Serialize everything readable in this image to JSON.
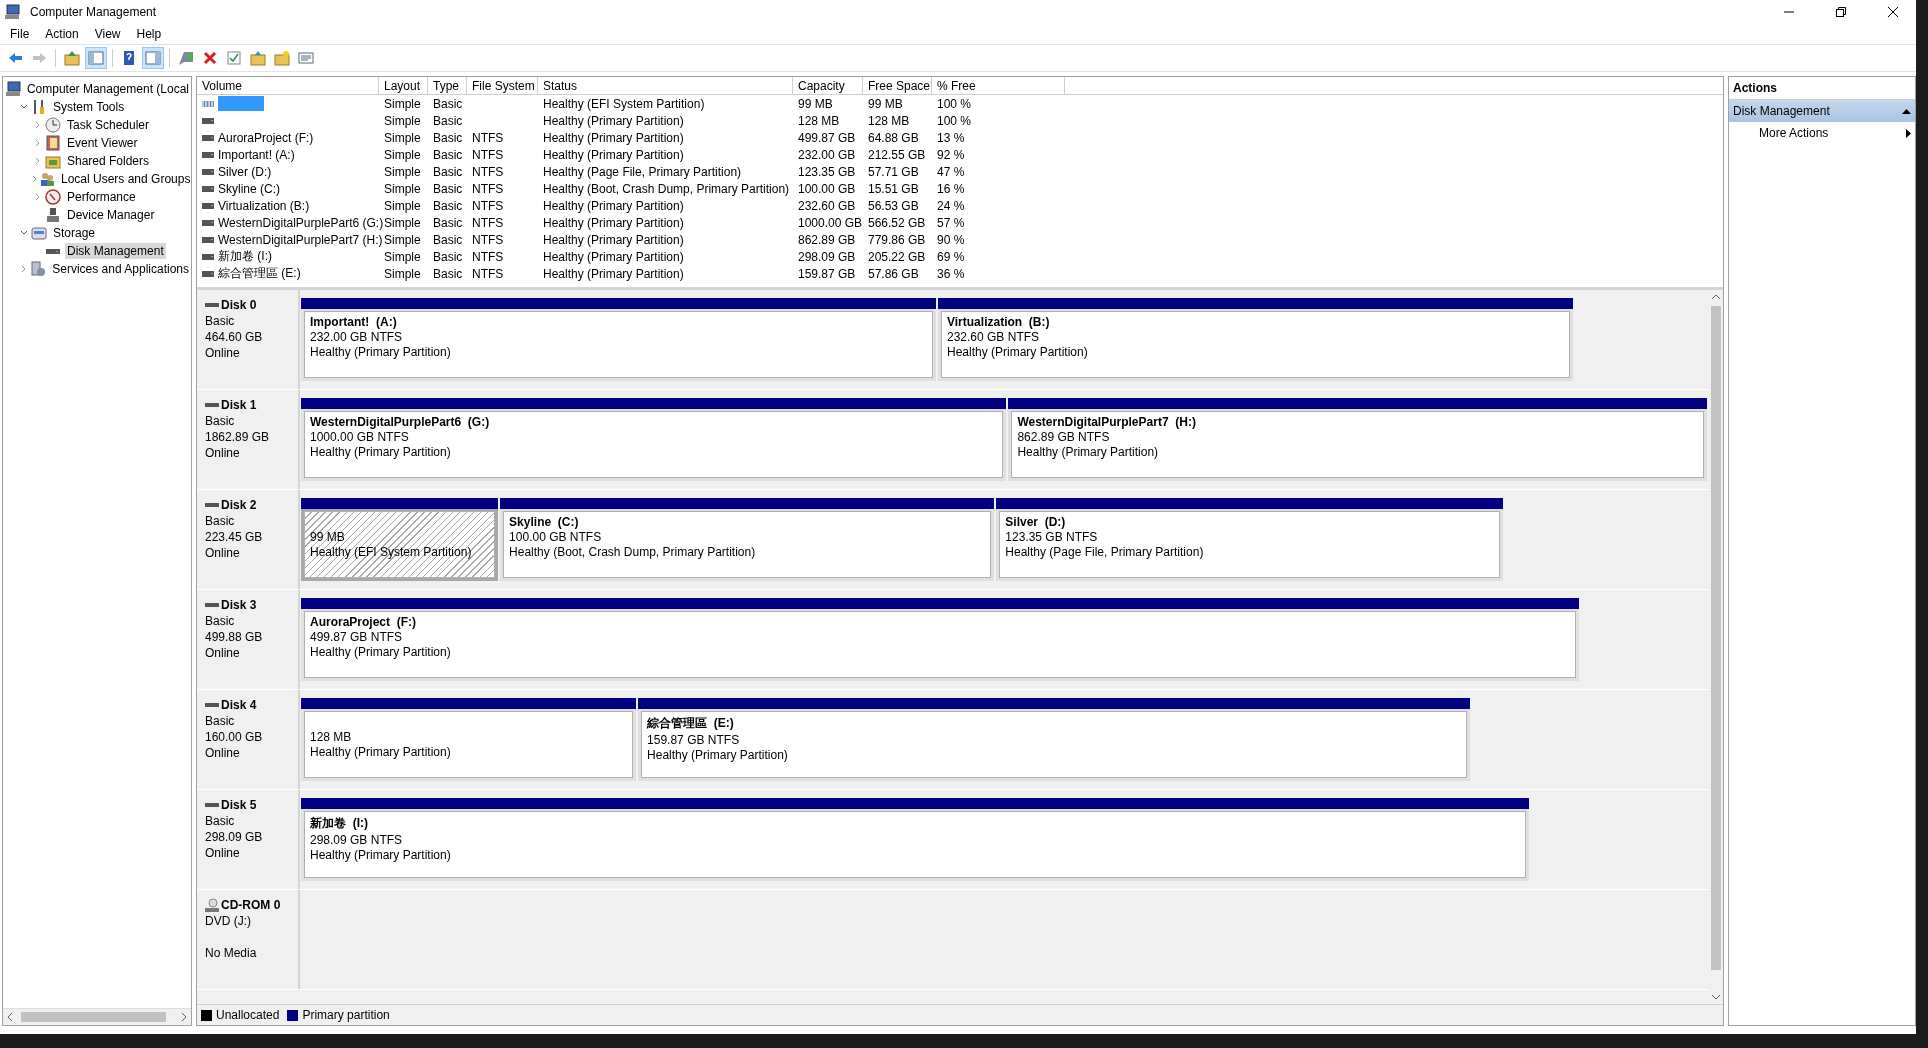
{
  "window": {
    "title": "Computer Management"
  },
  "menu": [
    "File",
    "Action",
    "View",
    "Help"
  ],
  "toolbar": [
    {
      "kind": "back",
      "disabled": false,
      "pressed": false
    },
    {
      "kind": "forward",
      "disabled": true,
      "pressed": false
    },
    {
      "kind": "separator"
    },
    {
      "kind": "up",
      "disabled": false,
      "pressed": false
    },
    {
      "kind": "tree-pane",
      "disabled": false,
      "pressed": true
    },
    {
      "kind": "separator"
    },
    {
      "kind": "help",
      "disabled": false,
      "pressed": false
    },
    {
      "kind": "action-pane",
      "disabled": false,
      "pressed": true
    },
    {
      "kind": "separator"
    },
    {
      "kind": "connect",
      "disabled": false,
      "pressed": false
    },
    {
      "kind": "delete",
      "disabled": false,
      "pressed": false
    },
    {
      "kind": "properties",
      "disabled": false,
      "pressed": false
    },
    {
      "kind": "folder-up",
      "disabled": false,
      "pressed": false
    },
    {
      "kind": "folder-star",
      "disabled": false,
      "pressed": false
    },
    {
      "kind": "list",
      "disabled": false,
      "pressed": false
    }
  ],
  "tree": [
    {
      "label": "Computer Management (Local",
      "selected": false,
      "children": [
        {
          "label": "System Tools",
          "expanded": true,
          "selected": false,
          "children": [
            {
              "label": "Task Scheduler",
              "expanded": false,
              "selected": false
            },
            {
              "label": "Event Viewer",
              "expanded": false,
              "selected": false
            },
            {
              "label": "Shared Folders",
              "expanded": false,
              "selected": false
            },
            {
              "label": "Local Users and Groups",
              "expanded": false,
              "selected": false
            },
            {
              "label": "Performance",
              "expanded": false,
              "selected": false
            },
            {
              "label": "Device Manager",
              "selected": false
            }
          ]
        },
        {
          "label": "Storage",
          "expanded": true,
          "selected": false,
          "children": [
            {
              "label": "Disk Management",
              "selected": true
            }
          ]
        },
        {
          "label": "Services and Applications",
          "expanded": false,
          "selected": false
        }
      ]
    }
  ],
  "volumes": {
    "columns": [
      "Volume",
      "Layout",
      "Type",
      "File System",
      "Status",
      "Capacity",
      "Free Space",
      "% Free"
    ],
    "rows": [
      {
        "kind": "efi",
        "selected": true,
        "layout": "Simple",
        "type": "Basic",
        "status": "Healthy (EFI System Partition)",
        "capacity": "99 MB",
        "free_space": "99 MB",
        "pct_free": "100 %"
      },
      {
        "kind": "disk",
        "selected": false,
        "layout": "Simple",
        "type": "Basic",
        "status": "Healthy (Primary Partition)",
        "capacity": "128 MB",
        "free_space": "128 MB",
        "pct_free": "100 %"
      },
      {
        "kind": "disk",
        "selected": false,
        "volume": "AuroraProject (F:)",
        "layout": "Simple",
        "type": "Basic",
        "file_system": "NTFS",
        "status": "Healthy (Primary Partition)",
        "capacity": "499.87 GB",
        "free_space": "64.88 GB",
        "pct_free": "13 %"
      },
      {
        "kind": "disk",
        "selected": false,
        "volume": "Important! (A:)",
        "layout": "Simple",
        "type": "Basic",
        "file_system": "NTFS",
        "status": "Healthy (Primary Partition)",
        "capacity": "232.00 GB",
        "free_space": "212.55 GB",
        "pct_free": "92 %"
      },
      {
        "kind": "disk",
        "selected": false,
        "volume": "Silver (D:)",
        "layout": "Simple",
        "type": "Basic",
        "file_system": "NTFS",
        "status": "Healthy (Page File, Primary Partition)",
        "capacity": "123.35 GB",
        "free_space": "57.71 GB",
        "pct_free": "47 %"
      },
      {
        "kind": "disk",
        "selected": false,
        "volume": "Skyline (C:)",
        "layout": "Simple",
        "type": "Basic",
        "file_system": "NTFS",
        "status": "Healthy (Boot, Crash Dump, Primary Partition)",
        "capacity": "100.00 GB",
        "free_space": "15.51 GB",
        "pct_free": "16 %"
      },
      {
        "kind": "disk",
        "selected": false,
        "volume": "Virtualization (B:)",
        "layout": "Simple",
        "type": "Basic",
        "file_system": "NTFS",
        "status": "Healthy (Primary Partition)",
        "capacity": "232.60 GB",
        "free_space": "56.53 GB",
        "pct_free": "24 %"
      },
      {
        "kind": "disk",
        "selected": false,
        "volume": "WesternDigitalPurplePart6 (G:)",
        "layout": "Simple",
        "type": "Basic",
        "file_system": "NTFS",
        "status": "Healthy (Primary Partition)",
        "capacity": "1000.00 GB",
        "free_space": "566.52 GB",
        "pct_free": "57 %"
      },
      {
        "kind": "disk",
        "selected": false,
        "volume": "WesternDigitalPurplePart7 (H:)",
        "layout": "Simple",
        "type": "Basic",
        "file_system": "NTFS",
        "status": "Healthy (Primary Partition)",
        "capacity": "862.89 GB",
        "free_space": "779.86 GB",
        "pct_free": "90 %"
      },
      {
        "kind": "disk",
        "selected": false,
        "volume": "新加卷 (I:)",
        "layout": "Simple",
        "type": "Basic",
        "file_system": "NTFS",
        "status": "Healthy (Primary Partition)",
        "capacity": "298.09 GB",
        "free_space": "205.22 GB",
        "pct_free": "69 %"
      },
      {
        "kind": "disk",
        "selected": false,
        "volume": "綜合管理區 (E:)",
        "layout": "Simple",
        "type": "Basic",
        "file_system": "NTFS",
        "status": "Healthy (Primary Partition)",
        "capacity": "159.87 GB",
        "free_space": "57.86 GB",
        "pct_free": "36 %"
      }
    ]
  },
  "disks": [
    {
      "kind": "disk",
      "name": "Disk 0",
      "type": "Basic",
      "size": "464.60 GB",
      "status": "Online",
      "partitions": [
        {
          "name": "Important!  (A:)",
          "size": "232.00 GB NTFS",
          "status": "Healthy (Primary Partition)",
          "selected": false
        },
        {
          "name": "Virtualization  (B:)",
          "size": "232.60 GB NTFS",
          "status": "Healthy (Primary Partition)",
          "selected": false
        }
      ]
    },
    {
      "kind": "disk",
      "name": "Disk 1",
      "type": "Basic",
      "size": "1862.89 GB",
      "status": "Online",
      "partitions": [
        {
          "name": "WesternDigitalPurplePart6  (G:)",
          "size": "1000.00 GB NTFS",
          "status": "Healthy (Primary Partition)",
          "selected": false
        },
        {
          "name": "WesternDigitalPurplePart7  (H:)",
          "size": "862.89 GB NTFS",
          "status": "Healthy (Primary Partition)",
          "selected": false
        }
      ]
    },
    {
      "kind": "disk",
      "name": "Disk 2",
      "type": "Basic",
      "size": "223.45 GB",
      "status": "Online",
      "partitions": [
        {
          "size": "99 MB",
          "status": "Healthy (EFI System Partition)",
          "selected": true
        },
        {
          "name": "Skyline  (C:)",
          "size": "100.00 GB NTFS",
          "status": "Healthy (Boot, Crash Dump, Primary Partition)",
          "selected": false
        },
        {
          "name": "Silver  (D:)",
          "size": "123.35 GB NTFS",
          "status": "Healthy (Page File, Primary Partition)",
          "selected": false
        }
      ]
    },
    {
      "kind": "disk",
      "name": "Disk 3",
      "type": "Basic",
      "size": "499.88 GB",
      "status": "Online",
      "partitions": [
        {
          "name": "AuroraProject  (F:)",
          "size": "499.87 GB NTFS",
          "status": "Healthy (Primary Partition)",
          "selected": false
        }
      ]
    },
    {
      "kind": "disk",
      "name": "Disk 4",
      "type": "Basic",
      "size": "160.00 GB",
      "status": "Online",
      "partitions": [
        {
          "size": "128 MB",
          "status": "Healthy (Primary Partition)",
          "selected": false
        },
        {
          "name": "綜合管理區  (E:)",
          "size": "159.87 GB NTFS",
          "status": "Healthy (Primary Partition)",
          "selected": false
        }
      ]
    },
    {
      "kind": "disk",
      "name": "Disk 5",
      "type": "Basic",
      "size": "298.09 GB",
      "status": "Online",
      "partitions": [
        {
          "name": "新加卷  (I:)",
          "size": "298.09 GB NTFS",
          "status": "Healthy (Primary Partition)",
          "selected": false
        }
      ]
    },
    {
      "kind": "cdrom",
      "name": "CD-ROM 0",
      "type": "DVD (J:)",
      "status": "No Media"
    }
  ],
  "legend": [
    {
      "label": "Unallocated",
      "color": "#000000"
    },
    {
      "label": "Primary partition",
      "color": "#000080"
    }
  ],
  "actions": {
    "title": "Actions",
    "section": {
      "label": "Disk Management",
      "expanded": true
    },
    "items": [
      "More Actions"
    ]
  }
}
